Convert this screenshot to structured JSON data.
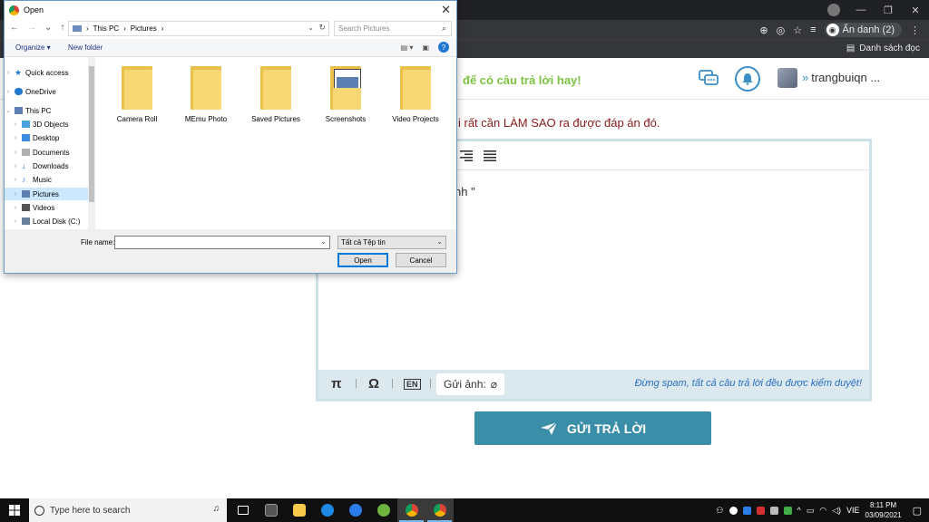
{
  "browser": {
    "profile_label": "Ẩn danh (2)",
    "reading_list_label": "Danh sách đọc"
  },
  "site": {
    "slogan": "để có câu trả lời hay!",
    "username": "trangbuiqn ...",
    "question_text": "i rất cần LÀM SAO ra được đáp án đó.",
    "editor_text": "nh \"",
    "attach_label": "Gửi ảnh:",
    "warning_text": "Đừng spam, tất cả câu trả lời đều được kiểm duyệt!",
    "submit_label": "GỬI TRẢ LỜI",
    "toolbar_symbols": {
      "pi": "π",
      "omega": "Ω",
      "en": "EN"
    }
  },
  "dialog": {
    "title": "Open",
    "breadcrumb": [
      "This PC",
      "Pictures"
    ],
    "search_placeholder": "Search Pictures",
    "organize_label": "Organize ▾",
    "new_folder_label": "New folder",
    "tree": [
      {
        "label": "Quick access",
        "icon": "star-icon",
        "color": "#1f77d0"
      },
      {
        "label": "OneDrive",
        "icon": "cloud-icon",
        "color": "#1f77d0"
      },
      {
        "label": "This PC",
        "icon": "pc-icon",
        "color": "#5a7fb0"
      },
      {
        "label": "3D Objects",
        "icon": "cube-icon",
        "color": "#4aa3df"
      },
      {
        "label": "Desktop",
        "icon": "desktop-icon",
        "color": "#3c8de0"
      },
      {
        "label": "Documents",
        "icon": "document-icon",
        "color": "#8a8a8a"
      },
      {
        "label": "Downloads",
        "icon": "download-icon",
        "color": "#1f77d0"
      },
      {
        "label": "Music",
        "icon": "music-icon",
        "color": "#3c8de0"
      },
      {
        "label": "Pictures",
        "icon": "pictures-icon",
        "color": "#5a7fb0"
      },
      {
        "label": "Videos",
        "icon": "video-icon",
        "color": "#555555"
      },
      {
        "label": "Local Disk (C:)",
        "icon": "disk-icon",
        "color": "#6a7f99"
      }
    ],
    "files": [
      "Camera Roll",
      "MEmu Photo",
      "Saved Pictures",
      "Screenshots",
      "Video Projects"
    ],
    "filename_label": "File name:",
    "filename_value": "",
    "filetype_value": "Tất cả Tệp tin",
    "open_label": "Open",
    "cancel_label": "Cancel"
  },
  "taskbar": {
    "search_placeholder": "Type here to search",
    "language": "VIE",
    "time": "8:11 PM",
    "date": "03/09/2021"
  }
}
